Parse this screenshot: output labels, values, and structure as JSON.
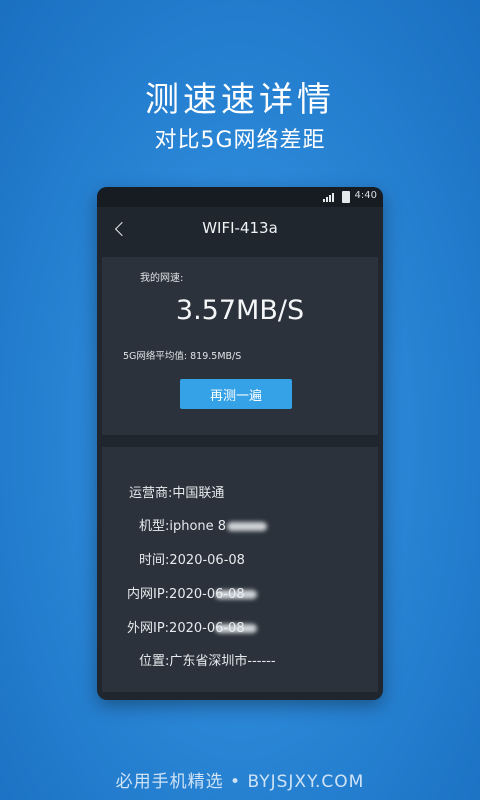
{
  "promo": {
    "title": "测速速详情",
    "subtitle": "对比5G网络差距"
  },
  "statusbar": {
    "time": "4:40"
  },
  "navbar": {
    "title": "WIFI-413a"
  },
  "speed_card": {
    "label": "我的网速:",
    "value": "3.57MB/S",
    "avg_label": "5G网络平均值:",
    "avg_value": "819.5MB/S",
    "retest_label": "再测一遍"
  },
  "info": {
    "carrier": "运营商:中国联通",
    "model": "机型:iphone 8",
    "time": "时间:2020-06-08",
    "lan_ip": "内网IP:2020-06-08",
    "wan_ip": "外网IP:2020-06-08",
    "location": "位置:广东省深圳市------"
  },
  "footer": {
    "text": "必用手机精选 • BYJSJXY.COM"
  },
  "colors": {
    "background": "#2a86d6",
    "phone_bg": "#1f262e",
    "card_bg": "#2b323b",
    "button": "#35a1e6"
  }
}
